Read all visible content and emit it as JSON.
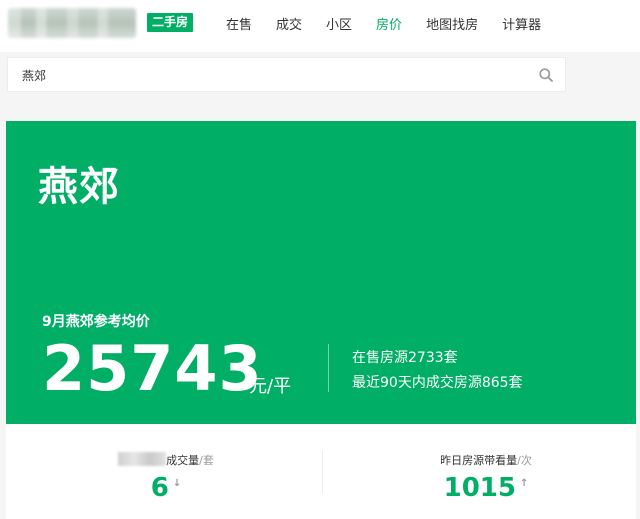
{
  "header": {
    "badge": "二手房",
    "nav": [
      {
        "label": "在售",
        "active": false
      },
      {
        "label": "成交",
        "active": false
      },
      {
        "label": "小区",
        "active": false
      },
      {
        "label": "房价",
        "active": true
      },
      {
        "label": "地图找房",
        "active": false
      },
      {
        "label": "计算器",
        "active": false
      }
    ]
  },
  "search": {
    "value": "燕郊",
    "icon": "search-icon"
  },
  "hero": {
    "title": "燕郊",
    "price_label": "9月燕郊参考均价",
    "price": "25743",
    "price_unit": "元/平",
    "on_sale": "在售房源2733套",
    "recent_sold": "最近90天内成交房源865套"
  },
  "stats": [
    {
      "label": "成交量",
      "unit": "/套",
      "value": "6",
      "trend": "↓"
    },
    {
      "label": "昨日房源带看量",
      "unit": "/次",
      "value": "1015",
      "trend": "↑"
    }
  ],
  "colors": {
    "brand": "#00ae66"
  }
}
